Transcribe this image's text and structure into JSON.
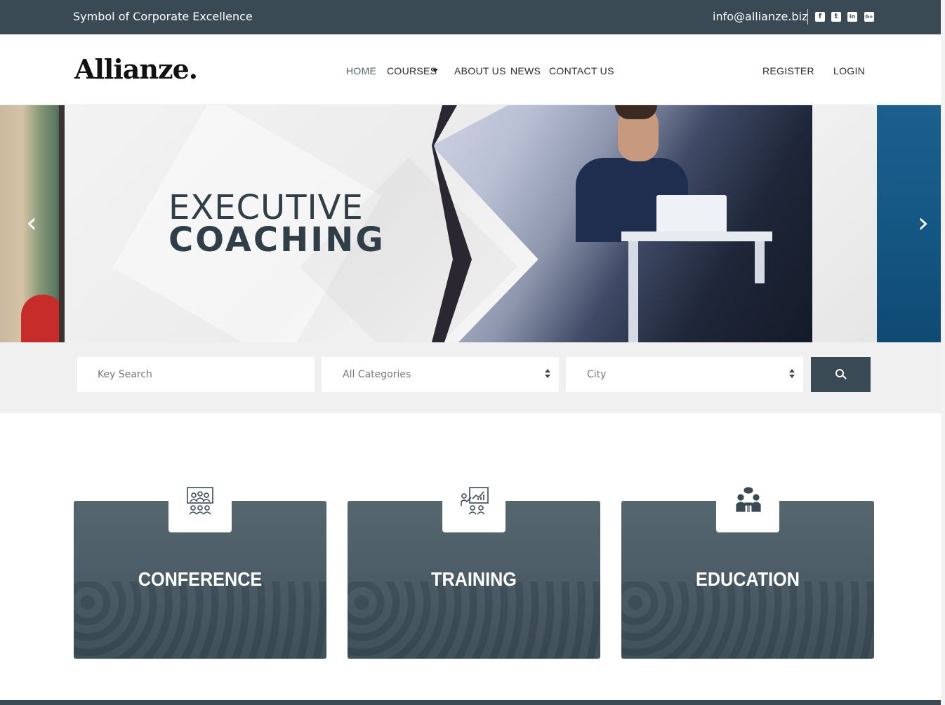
{
  "topbar": {
    "tagline": "Symbol of Corporate Excellence",
    "email": "info@allianze.biz",
    "social": [
      "facebook-icon",
      "twitter-icon",
      "linkedin-icon",
      "googleplus-icon"
    ],
    "social_glyphs": [
      "f",
      "t",
      "in",
      "G+"
    ]
  },
  "header": {
    "logo": "Allianze.",
    "nav": {
      "home": "HOME",
      "courses": "COURSES",
      "about": "ABOUT US",
      "news": "NEWS",
      "contact": "CONTACT US",
      "register": "REGISTER",
      "login": "LOGIN"
    }
  },
  "hero": {
    "line1": "EXECUTIVE",
    "line2": "COACHING",
    "prev_glyph": "‹",
    "next_glyph": "›"
  },
  "search": {
    "keyword_placeholder": "Key Search",
    "category_value": "All Categories",
    "city_value": "City"
  },
  "cards": [
    {
      "title": "CONFERENCE",
      "icon": "conference-icon"
    },
    {
      "title": "TRAINING",
      "icon": "training-icon"
    },
    {
      "title": "EDUCATION",
      "icon": "education-icon"
    }
  ],
  "colors": {
    "primary": "#3a4a54",
    "hero_text": "#2f3e47"
  }
}
